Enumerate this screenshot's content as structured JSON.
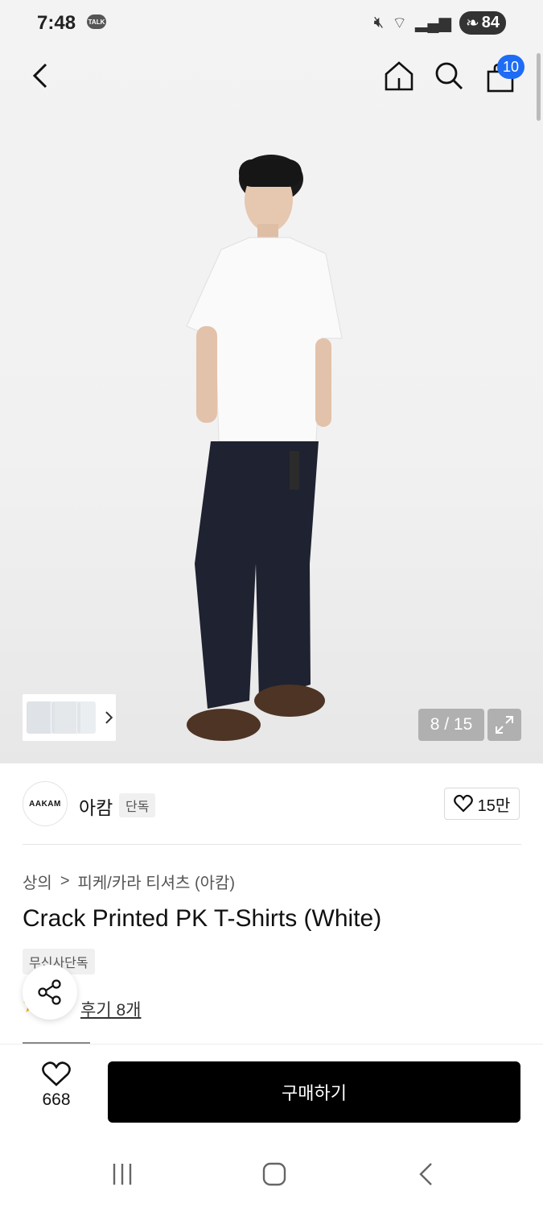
{
  "status": {
    "time": "7:48",
    "talk_label": "TALK",
    "battery": "84"
  },
  "gallery": {
    "counter": "8 / 15"
  },
  "cart": {
    "badge": "10"
  },
  "brand": {
    "logo_text": "AAKAM",
    "name": "아캄",
    "tag": "단독",
    "likes": "15만"
  },
  "breadcrumb": {
    "category": "상의",
    "separator": ">",
    "subcategory": "피케/카라 티셔츠 (아캄)"
  },
  "product": {
    "title": "Crack Printed PK T-Shirts (White)",
    "exclusive_tag": "무신사단독",
    "review_link": "후기 8개"
  },
  "bottom": {
    "wish_count": "668",
    "buy_label": "구매하기"
  },
  "colors": {
    "badge_blue": "#1e6cf5",
    "buy_button": "#000000"
  }
}
